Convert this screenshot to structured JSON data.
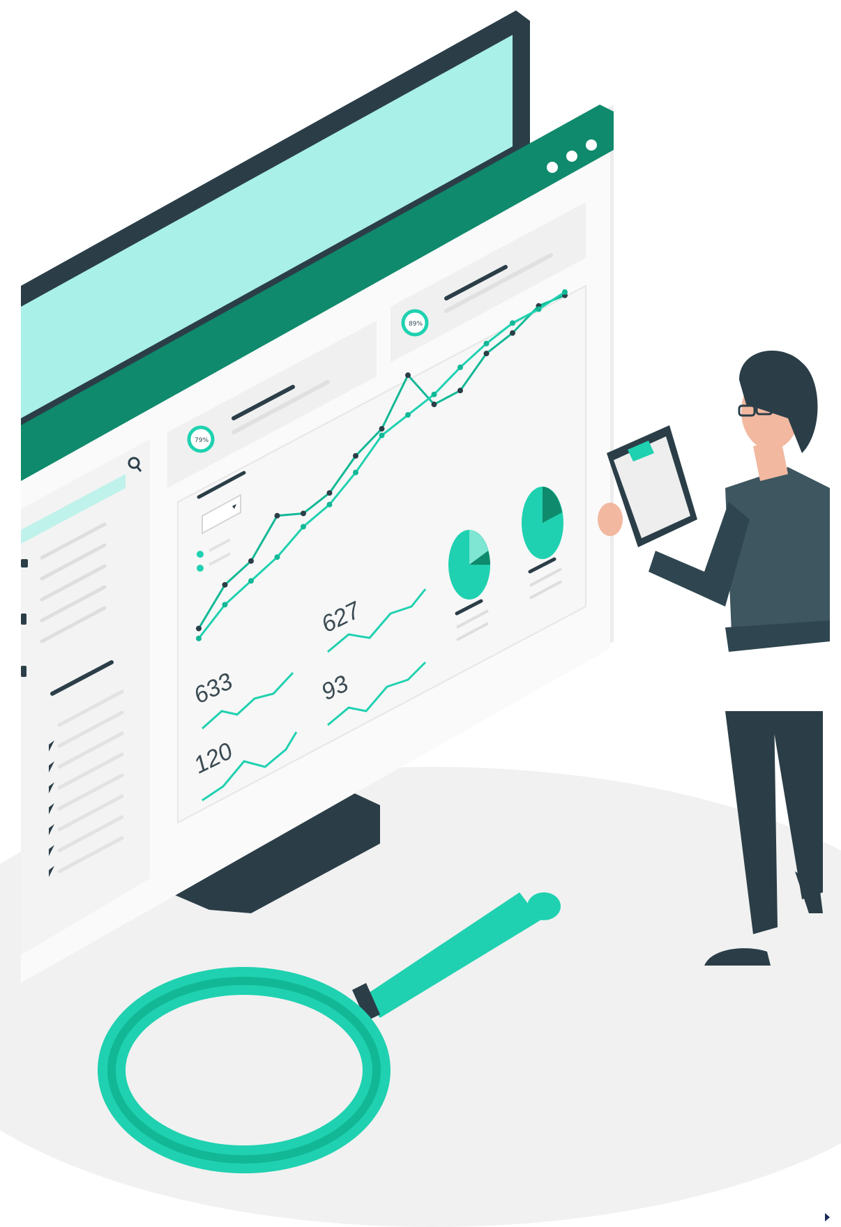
{
  "palette": {
    "accent": "#1fd1b0",
    "accent_dark": "#0f8a6c",
    "navy": "#2b3e48",
    "screen_mint": "#a9f0e8",
    "panel": "#f6f6f6"
  },
  "dashboard": {
    "search_icon": "search-icon",
    "window_dots": [
      "dot-1",
      "dot-2",
      "dot-3"
    ],
    "kpi_badge_left": "79%",
    "kpi_badge_right": "89%",
    "metrics": {
      "m1": "633",
      "m2": "627",
      "m3": "93",
      "m4": "120"
    },
    "line_chart": {
      "series_a_level": [
        0.12,
        0.3,
        0.36,
        0.55,
        0.48,
        0.52,
        0.66,
        0.74,
        0.98,
        0.72,
        0.72,
        0.86,
        0.9,
        0.98,
        0.96
      ],
      "series_b_level": [
        0.06,
        0.18,
        0.24,
        0.3,
        0.4,
        0.45,
        0.56,
        0.7,
        0.74,
        0.78,
        0.86,
        0.92,
        0.96,
        0.96,
        0.98
      ]
    }
  }
}
